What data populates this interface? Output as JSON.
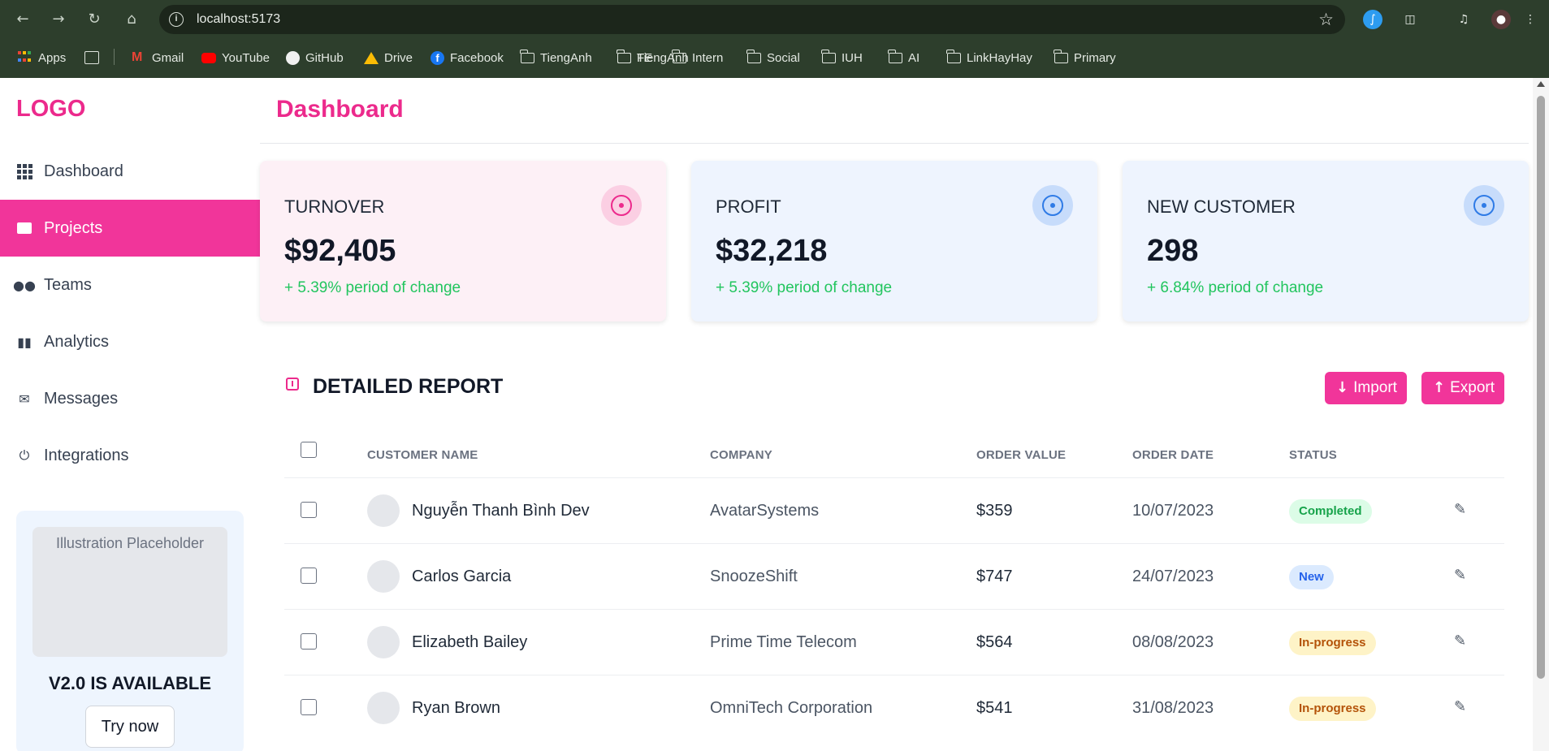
{
  "browser": {
    "url": "localhost:5173",
    "nav_icons": [
      "back-icon",
      "forward-icon",
      "reload-icon",
      "home-icon"
    ],
    "bookmarks": [
      {
        "label": "Apps",
        "icon": "apps-grid-icon"
      },
      {
        "label": "",
        "icon": "tab-groups-icon"
      },
      {
        "label": "Gmail",
        "icon": "gmail-icon"
      },
      {
        "label": "YouTube",
        "icon": "youtube-icon"
      },
      {
        "label": "GitHub",
        "icon": "github-icon"
      },
      {
        "label": "Drive",
        "icon": "drive-icon"
      },
      {
        "label": "Facebook",
        "icon": "facebook-icon"
      },
      {
        "label": "TiengAnh",
        "icon": "folder-icon"
      },
      {
        "label": "FE",
        "icon": "folder-icon"
      },
      {
        "label": "Intern",
        "icon": "folder-icon"
      },
      {
        "label": "Social",
        "icon": "folder-icon"
      },
      {
        "label": "IUH",
        "icon": "folder-icon"
      },
      {
        "label": "AI",
        "icon": "folder-icon"
      },
      {
        "label": "LinkHayHay",
        "icon": "folder-icon"
      },
      {
        "label": "Primary",
        "icon": "folder-icon"
      }
    ]
  },
  "sidebar": {
    "logo": "LOGO",
    "items": [
      {
        "label": "Dashboard",
        "icon": "grid-icon",
        "active": false
      },
      {
        "label": "Projects",
        "icon": "folder-icon",
        "active": true
      },
      {
        "label": "Teams",
        "icon": "users-icon",
        "active": false
      },
      {
        "label": "Analytics",
        "icon": "bar-chart-icon",
        "active": false
      },
      {
        "label": "Messages",
        "icon": "envelope-icon",
        "active": false
      },
      {
        "label": "Integrations",
        "icon": "plug-icon",
        "active": false
      }
    ],
    "promo": {
      "image_placeholder": "Illustration Placeholder",
      "title": "V2.0 IS AVAILABLE",
      "button": "Try now"
    }
  },
  "main": {
    "title": "Dashboard",
    "cards": [
      {
        "label": "TURNOVER",
        "value": "$92,405",
        "change": "+ 5.39% period of change",
        "bg": "#fdf0f6",
        "icon_bg": "#fbcfe3",
        "icon_color": "#ec2a8c"
      },
      {
        "label": "PROFIT",
        "value": "$32,218",
        "change": "+ 5.39% period of change",
        "bg": "#eef4fe",
        "icon_bg": "#c7dcfb",
        "icon_color": "#2f7be6"
      },
      {
        "label": "NEW CUSTOMER",
        "value": "298",
        "change": "+ 6.84% period of change",
        "bg": "#eef4fe",
        "icon_bg": "#c7dcfb",
        "icon_color": "#2f7be6"
      }
    ],
    "report": {
      "title": "DETAILED REPORT",
      "import_label": "Import",
      "export_label": "Export",
      "columns": [
        "CUSTOMER NAME",
        "COMPANY",
        "ORDER VALUE",
        "ORDER DATE",
        "STATUS"
      ],
      "rows": [
        {
          "name": "Nguyễn Thanh Bình Dev",
          "company": "AvatarSystems",
          "value": "$359",
          "date": "10/07/2023",
          "status": "Completed"
        },
        {
          "name": "Carlos Garcia",
          "company": "SnoozeShift",
          "value": "$747",
          "date": "24/07/2023",
          "status": "New"
        },
        {
          "name": "Elizabeth Bailey",
          "company": "Prime Time Telecom",
          "value": "$564",
          "date": "08/08/2023",
          "status": "In-progress"
        },
        {
          "name": "Ryan Brown",
          "company": "OmniTech Corporation",
          "value": "$541",
          "date": "31/08/2023",
          "status": "In-progress"
        }
      ],
      "status_colors": {
        "Completed": {
          "bg": "#dcfce7",
          "fg": "#16a34a"
        },
        "New": {
          "bg": "#dbeafe",
          "fg": "#2563eb"
        },
        "In-progress": {
          "bg": "#fef3c7",
          "fg": "#b45309"
        }
      }
    }
  }
}
